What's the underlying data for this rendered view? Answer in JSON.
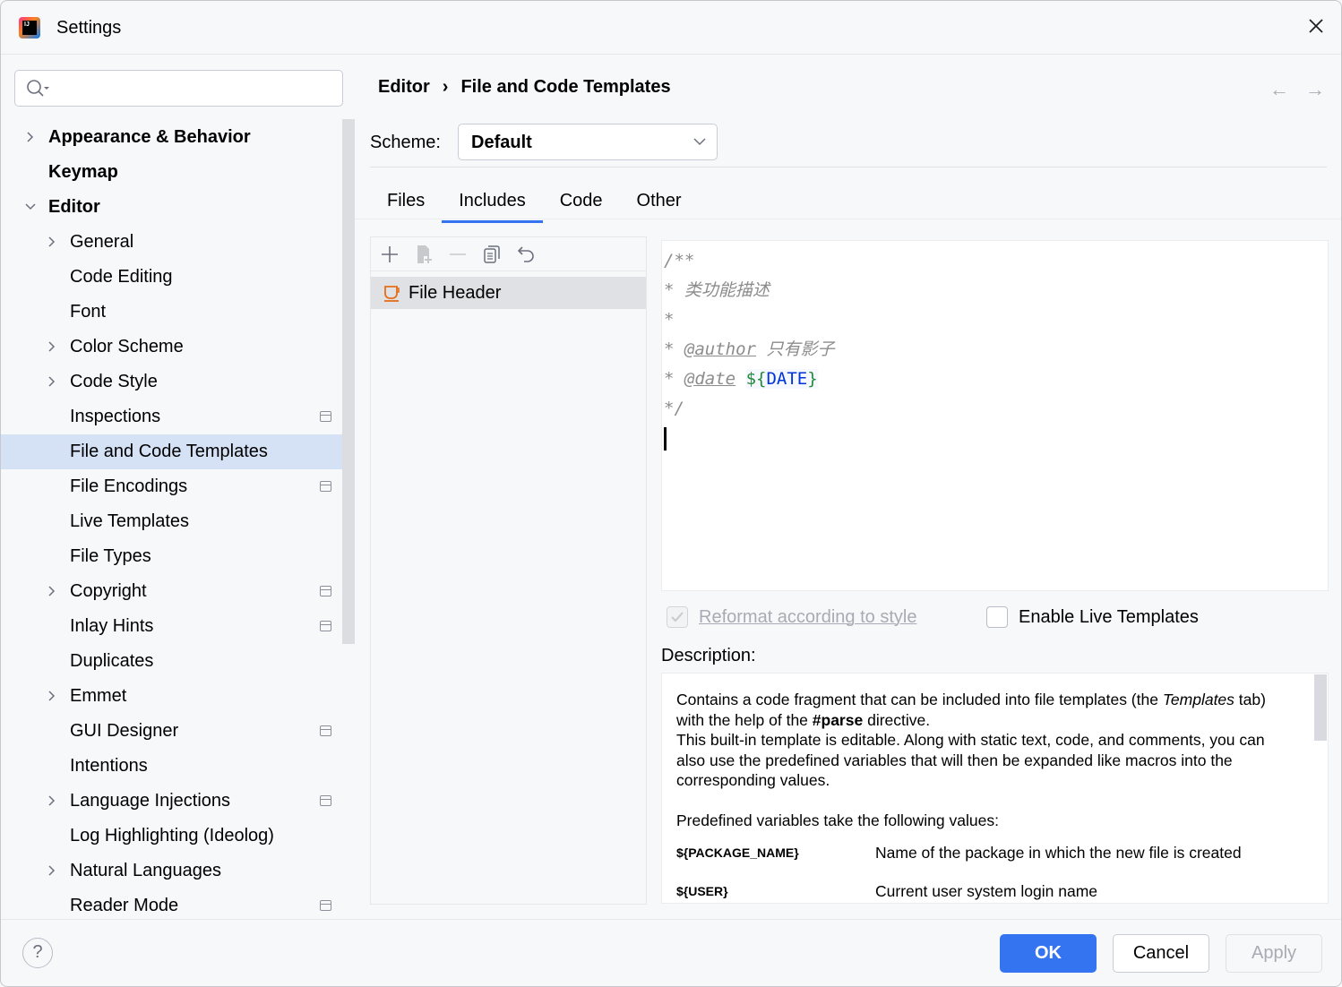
{
  "window": {
    "title": "Settings"
  },
  "search": {
    "placeholder": "",
    "value": ""
  },
  "sidebar": {
    "items": [
      {
        "label": "Appearance & Behavior",
        "level": 0,
        "expander": "collapsed",
        "bold": true,
        "project": false
      },
      {
        "label": "Keymap",
        "level": 0,
        "expander": "none",
        "bold": true,
        "project": false
      },
      {
        "label": "Editor",
        "level": 0,
        "expander": "expanded",
        "bold": true,
        "project": false
      },
      {
        "label": "General",
        "level": 1,
        "expander": "collapsed",
        "project": false
      },
      {
        "label": "Code Editing",
        "level": 1,
        "expander": "none",
        "project": false
      },
      {
        "label": "Font",
        "level": 1,
        "expander": "none",
        "project": false
      },
      {
        "label": "Color Scheme",
        "level": 1,
        "expander": "collapsed",
        "project": false
      },
      {
        "label": "Code Style",
        "level": 1,
        "expander": "collapsed",
        "project": false
      },
      {
        "label": "Inspections",
        "level": 1,
        "expander": "none",
        "project": true
      },
      {
        "label": "File and Code Templates",
        "level": 1,
        "expander": "none",
        "project": false,
        "selected": true
      },
      {
        "label": "File Encodings",
        "level": 1,
        "expander": "none",
        "project": true
      },
      {
        "label": "Live Templates",
        "level": 1,
        "expander": "none",
        "project": false
      },
      {
        "label": "File Types",
        "level": 1,
        "expander": "none",
        "project": false
      },
      {
        "label": "Copyright",
        "level": 1,
        "expander": "collapsed",
        "project": true
      },
      {
        "label": "Inlay Hints",
        "level": 1,
        "expander": "none",
        "project": true
      },
      {
        "label": "Duplicates",
        "level": 1,
        "expander": "none",
        "project": false
      },
      {
        "label": "Emmet",
        "level": 1,
        "expander": "collapsed",
        "project": false
      },
      {
        "label": "GUI Designer",
        "level": 1,
        "expander": "none",
        "project": true
      },
      {
        "label": "Intentions",
        "level": 1,
        "expander": "none",
        "project": false
      },
      {
        "label": "Language Injections",
        "level": 1,
        "expander": "collapsed",
        "project": true
      },
      {
        "label": "Log Highlighting (Ideolog)",
        "level": 1,
        "expander": "none",
        "project": false
      },
      {
        "label": "Natural Languages",
        "level": 1,
        "expander": "collapsed",
        "project": false
      },
      {
        "label": "Reader Mode",
        "level": 1,
        "expander": "none",
        "project": true
      }
    ]
  },
  "breadcrumb": {
    "parent": "Editor",
    "separator": "›",
    "current": "File and Code Templates"
  },
  "scheme": {
    "label": "Scheme:",
    "value": "Default"
  },
  "tabs": [
    {
      "label": "Files"
    },
    {
      "label": "Includes",
      "active": true
    },
    {
      "label": "Code"
    },
    {
      "label": "Other"
    }
  ],
  "templates": {
    "items": [
      {
        "label": "File Header",
        "selected": true
      }
    ]
  },
  "editor": {
    "lines": {
      "l1": "/**",
      "l2_star": "*",
      "l2_text": "类功能描述",
      "l3": "*",
      "l4_star": "*",
      "l4_tag": "@author",
      "l4_text": "只有影子",
      "l5_star": "*",
      "l5_tag": "@date",
      "l5_var_open": "${",
      "l5_var_name": "DATE",
      "l5_var_close": "}",
      "l6": "*/"
    }
  },
  "options": {
    "reformat": {
      "label": "Reformat according to style",
      "checked": true,
      "disabled": true
    },
    "live": {
      "label": "Enable Live Templates",
      "checked": false
    }
  },
  "description": {
    "label": "Description:",
    "p1a": "Contains a code fragment that can be included into file templates (the ",
    "p1b": "Templates",
    "p1c": " tab) with the help of the ",
    "p1d": "#parse",
    "p1e": " directive.",
    "p2": "This built-in template is editable. Along with static text, code, and comments, you can also use the predefined variables that will then be expanded like macros into the corresponding values.",
    "p3": "Predefined variables take the following values:",
    "vars": [
      {
        "name": "${PACKAGE_NAME}",
        "desc": "Name of the package in which the new file is created"
      },
      {
        "name": "${USER}",
        "desc": "Current user system login name"
      }
    ]
  },
  "footer": {
    "help": "?",
    "ok": "OK",
    "cancel": "Cancel",
    "apply": "Apply"
  },
  "colors": {
    "accent": "#3574f0",
    "selection": "#d5e1f5",
    "template_icon": "#e66d17"
  }
}
